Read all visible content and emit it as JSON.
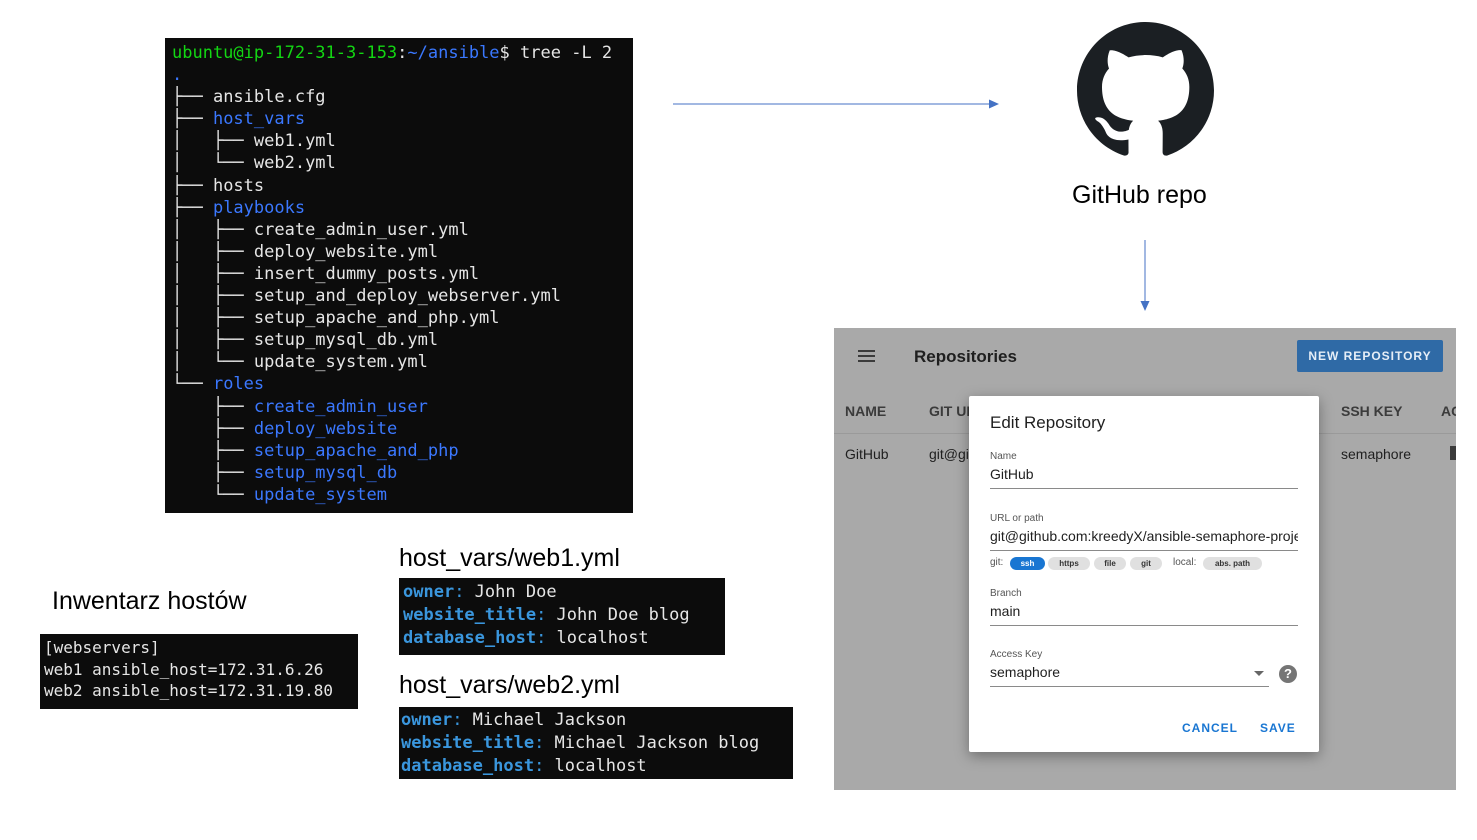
{
  "terminal": {
    "prompt_user": "ubuntu@ip-172-31-3-153",
    "prompt_sep": ":",
    "prompt_path": "~/ansible",
    "prompt_dollar": "$",
    "command": " tree -L 2",
    "lines": [
      {
        "prefix": ".",
        "name": "",
        "kind": "dot"
      },
      {
        "prefix": "├── ",
        "name": "ansible.cfg",
        "kind": "file"
      },
      {
        "prefix": "├── ",
        "name": "host_vars",
        "kind": "dir"
      },
      {
        "prefix": "│   ├── ",
        "name": "web1.yml",
        "kind": "file"
      },
      {
        "prefix": "│   └── ",
        "name": "web2.yml",
        "kind": "file"
      },
      {
        "prefix": "├── ",
        "name": "hosts",
        "kind": "file"
      },
      {
        "prefix": "├── ",
        "name": "playbooks",
        "kind": "dir"
      },
      {
        "prefix": "│   ├── ",
        "name": "create_admin_user.yml",
        "kind": "file"
      },
      {
        "prefix": "│   ├── ",
        "name": "deploy_website.yml",
        "kind": "file"
      },
      {
        "prefix": "│   ├── ",
        "name": "insert_dummy_posts.yml",
        "kind": "file"
      },
      {
        "prefix": "│   ├── ",
        "name": "setup_and_deploy_webserver.yml",
        "kind": "file"
      },
      {
        "prefix": "│   ├── ",
        "name": "setup_apache_and_php.yml",
        "kind": "file"
      },
      {
        "prefix": "│   ├── ",
        "name": "setup_mysql_db.yml",
        "kind": "file"
      },
      {
        "prefix": "│   └── ",
        "name": "update_system.yml",
        "kind": "file"
      },
      {
        "prefix": "└── ",
        "name": "roles",
        "kind": "dir"
      },
      {
        "prefix": "    ├── ",
        "name": "create_admin_user",
        "kind": "dir"
      },
      {
        "prefix": "    ├── ",
        "name": "deploy_website",
        "kind": "dir"
      },
      {
        "prefix": "    ├── ",
        "name": "setup_apache_and_php",
        "kind": "dir"
      },
      {
        "prefix": "    ├── ",
        "name": "setup_mysql_db",
        "kind": "dir"
      },
      {
        "prefix": "    └── ",
        "name": "update_system",
        "kind": "dir"
      }
    ]
  },
  "github": {
    "label": "GitHub repo",
    "icon": "github-icon"
  },
  "inventory": {
    "caption": "Inwentarz hostów",
    "lines": [
      "[webservers]",
      "web1 ansible_host=172.31.6.26",
      "web2 ansible_host=172.31.19.80"
    ]
  },
  "web1": {
    "caption": "host_vars/web1.yml",
    "rows": [
      {
        "key": "owner",
        "value": "John Doe"
      },
      {
        "key": "website_title",
        "value": "John Doe blog"
      },
      {
        "key": "database_host",
        "value": "localhost"
      }
    ]
  },
  "web2": {
    "caption": "host_vars/web2.yml",
    "rows": [
      {
        "key": "owner",
        "value": "Michael Jackson"
      },
      {
        "key": "website_title",
        "value": "Michael Jackson blog"
      },
      {
        "key": "database_host",
        "value": "localhost"
      }
    ]
  },
  "semaphore": {
    "title": "Repositories",
    "new_button": "NEW REPOSITORY",
    "columns": [
      "NAME",
      "GIT UR",
      "SSH KEY",
      "AC"
    ],
    "row": {
      "name": "GitHub",
      "git_url": "git@gi",
      "ssh_key": "semaphore"
    },
    "dialog": {
      "title": "Edit Repository",
      "name_label": "Name",
      "name_value": "GitHub",
      "url_label": "URL or path",
      "url_value": "git@github.com:kreedyX/ansible-semaphore-proje",
      "git_label": "git:",
      "git_chips": [
        "ssh",
        "https",
        "file",
        "git"
      ],
      "local_label": "local:",
      "local_chip": "abs. path",
      "branch_label": "Branch",
      "branch_value": "main",
      "key_label": "Access Key",
      "key_value": "semaphore",
      "cancel": "CANCEL",
      "save": "SAVE"
    }
  },
  "colors": {
    "terminal_bg": "#0c0c0c",
    "prompt_green": "#13d613",
    "dir_blue": "#3b78ff",
    "yaml_key": "#3a96dd",
    "semaphore_primary": "#1976d2",
    "panel_bg": "#a9a9a9",
    "arrow": "#4472c4"
  }
}
